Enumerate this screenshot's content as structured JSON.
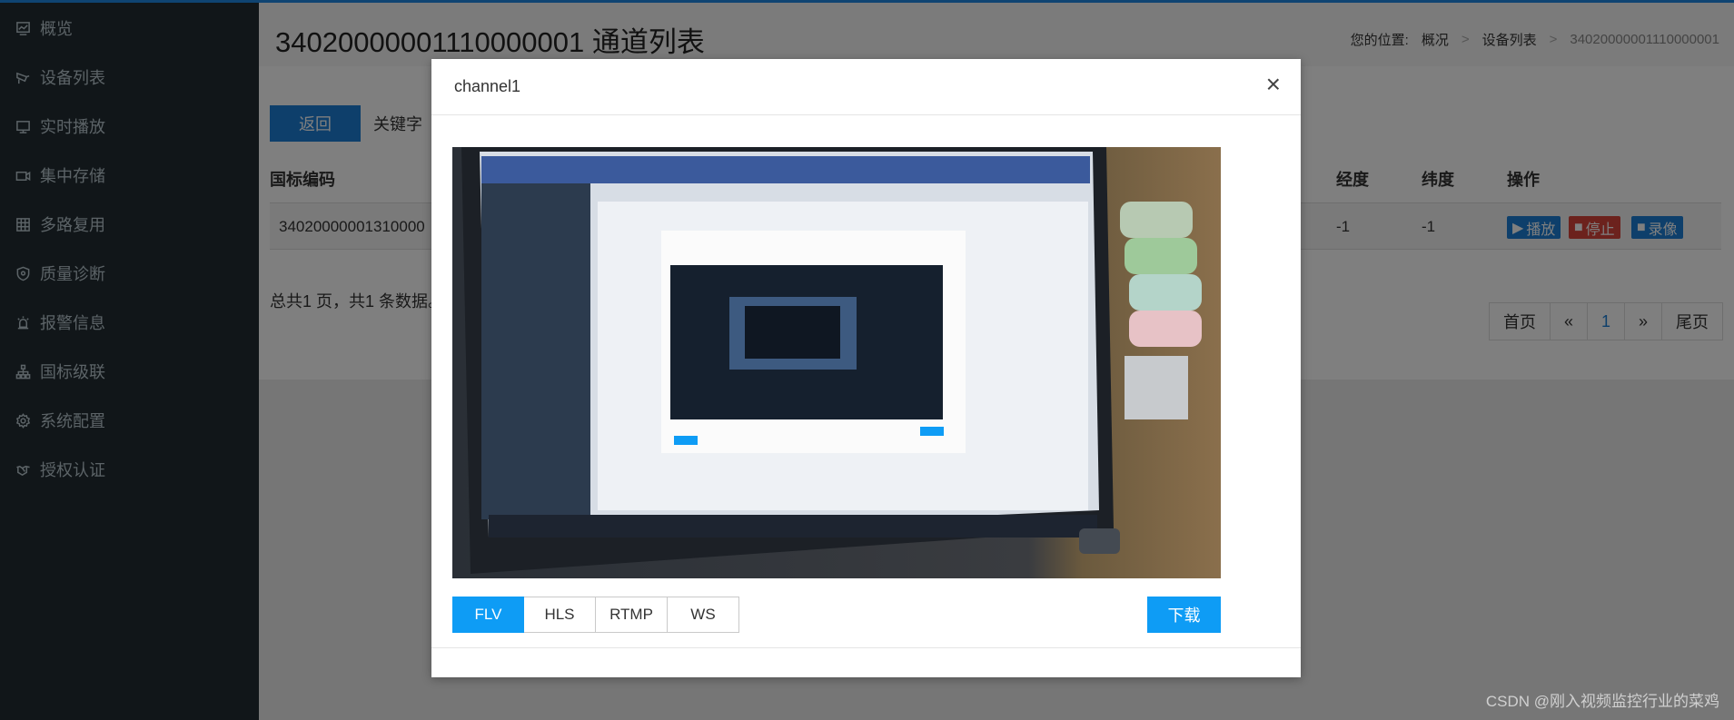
{
  "sidebar": {
    "items": [
      {
        "label": "概览",
        "icon": "dashboard-icon"
      },
      {
        "label": "设备列表",
        "icon": "camera-icon"
      },
      {
        "label": "实时播放",
        "icon": "monitor-icon"
      },
      {
        "label": "集中存储",
        "icon": "video-icon"
      },
      {
        "label": "多路复用",
        "icon": "grid-icon"
      },
      {
        "label": "质量诊断",
        "icon": "shield-icon"
      },
      {
        "label": "报警信息",
        "icon": "alarm-icon"
      },
      {
        "label": "国标级联",
        "icon": "sitemap-icon"
      },
      {
        "label": "系统配置",
        "icon": "gear-icon"
      },
      {
        "label": "授权认证",
        "icon": "handshake-icon"
      }
    ]
  },
  "header": {
    "title": "34020000001110000001 通道列表",
    "breadcrumb": {
      "prefix": "您的位置:",
      "items": [
        "概况",
        "设备列表",
        "34020000001110000001"
      ],
      "separator": ">"
    }
  },
  "toolbar": {
    "back_label": "返回",
    "keyword_label": "关键字"
  },
  "table": {
    "headers": {
      "code": "国标编码",
      "lon": "经度",
      "lat": "纬度",
      "ops": "操作"
    },
    "rows": [
      {
        "code": "34020000001310000",
        "lon": "-1",
        "lat": "-1"
      }
    ],
    "actions": {
      "play": "播放",
      "stop": "停止",
      "record": "录像"
    }
  },
  "pagination": {
    "summary": "总共1 页，共1 条数据。",
    "first": "首页",
    "prev": "«",
    "current": "1",
    "next": "»",
    "last": "尾页"
  },
  "modal": {
    "title": "channel1",
    "close": "×",
    "protocols": [
      "FLV",
      "HLS",
      "RTMP",
      "WS"
    ],
    "active_protocol": "FLV",
    "download_label": "下载"
  },
  "watermark": "CSDN @刚入视频监控行业的菜鸡",
  "colors": {
    "accent": "#1c7fd6",
    "modal_accent": "#0e9cf5",
    "danger": "#d9443a",
    "sidebar_bg": "#222d32"
  }
}
